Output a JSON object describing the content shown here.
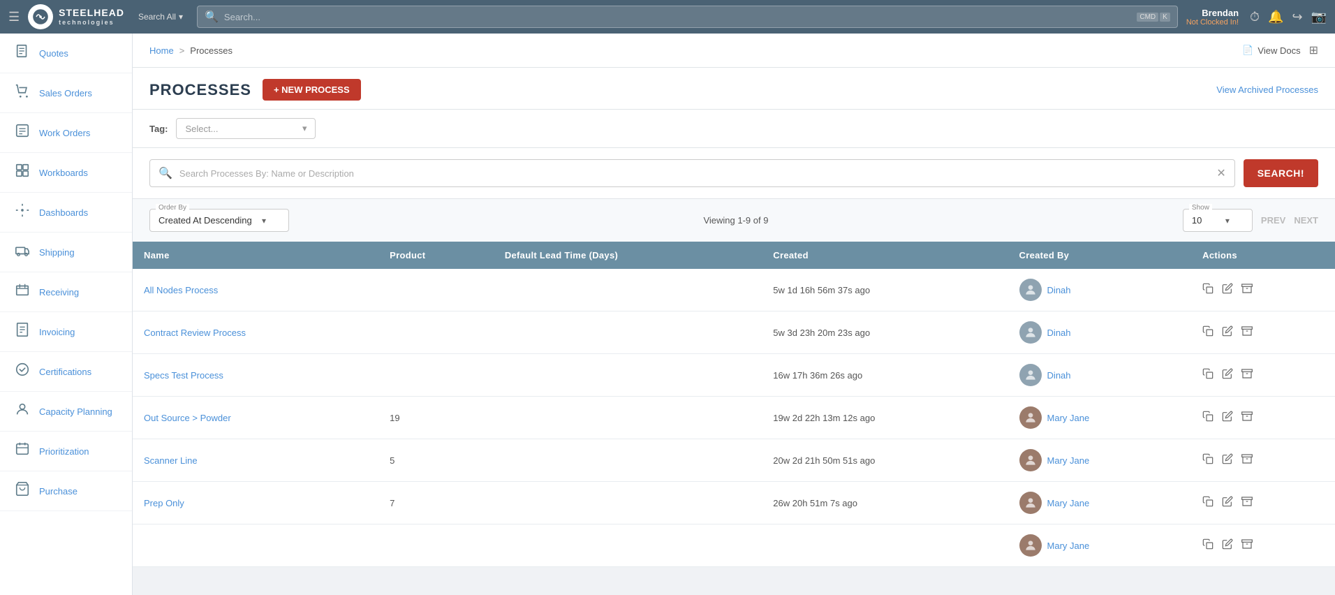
{
  "topNav": {
    "brand": "STEELHEAD",
    "brandSub": "technologies",
    "searchAllLabel": "Search All",
    "searchPlaceholder": "Search...",
    "cmdKey": "CMD",
    "kKey": "K",
    "user": {
      "name": "Brendan",
      "status": "Not Clocked In!"
    },
    "notificationCount": "0"
  },
  "breadcrumb": {
    "home": "Home",
    "separator": ">",
    "current": "Processes",
    "viewDocs": "View Docs"
  },
  "page": {
    "title": "PROCESSES",
    "newProcessLabel": "+ NEW PROCESS",
    "viewArchivedLabel": "View Archived Processes"
  },
  "filters": {
    "tagLabel": "Tag:",
    "tagPlaceholder": "Select..."
  },
  "searchBar": {
    "placeholder": "Search Processes By: Name or Description",
    "searchButton": "SEARCH!"
  },
  "controls": {
    "orderByLabel": "Order By",
    "orderByValue": "Created At Descending",
    "viewingInfo": "Viewing 1-9 of 9",
    "showLabel": "Show",
    "showValue": "10",
    "prevLabel": "PREV",
    "nextLabel": "NEXT"
  },
  "table": {
    "columns": [
      "Name",
      "Product",
      "Default Lead Time (Days)",
      "Created",
      "Created By",
      "Actions"
    ],
    "rows": [
      {
        "name": "All Nodes Process",
        "product": "",
        "leadTime": "",
        "created": "5w 1d 16h 56m 37s ago",
        "createdBy": "Dinah",
        "avatarType": "default"
      },
      {
        "name": "Contract Review Process",
        "product": "",
        "leadTime": "",
        "created": "5w 3d 23h 20m 23s ago",
        "createdBy": "Dinah",
        "avatarType": "default"
      },
      {
        "name": "Specs Test Process",
        "product": "",
        "leadTime": "",
        "created": "16w 17h 36m 26s ago",
        "createdBy": "Dinah",
        "avatarType": "default"
      },
      {
        "name": "Out Source > Powder",
        "product": "19",
        "leadTime": "",
        "created": "19w 2d 22h 13m 12s ago",
        "createdBy": "Mary Jane",
        "avatarType": "mary"
      },
      {
        "name": "Scanner Line",
        "product": "5",
        "leadTime": "",
        "created": "20w 2d 21h 50m 51s ago",
        "createdBy": "Mary Jane",
        "avatarType": "mary"
      },
      {
        "name": "Prep Only",
        "product": "7",
        "leadTime": "",
        "created": "26w 20h 51m 7s ago",
        "createdBy": "Mary Jane",
        "avatarType": "mary"
      },
      {
        "name": "",
        "product": "",
        "leadTime": "",
        "created": "",
        "createdBy": "Mary Jane",
        "avatarType": "mary"
      }
    ]
  },
  "sidebar": {
    "items": [
      {
        "label": "Quotes",
        "icon": "📄"
      },
      {
        "label": "Sales Orders",
        "icon": "🛒"
      },
      {
        "label": "Work Orders",
        "icon": "📋"
      },
      {
        "label": "Workboards",
        "icon": "📊"
      },
      {
        "label": "Dashboards",
        "icon": "📍"
      },
      {
        "label": "Shipping",
        "icon": "🚚"
      },
      {
        "label": "Receiving",
        "icon": "📦"
      },
      {
        "label": "Invoicing",
        "icon": "🗒️"
      },
      {
        "label": "Certifications",
        "icon": "⚙️"
      },
      {
        "label": "Capacity Planning",
        "icon": "👤"
      },
      {
        "label": "Prioritization",
        "icon": "📅"
      },
      {
        "label": "Purchase",
        "icon": "🛍️"
      }
    ]
  }
}
